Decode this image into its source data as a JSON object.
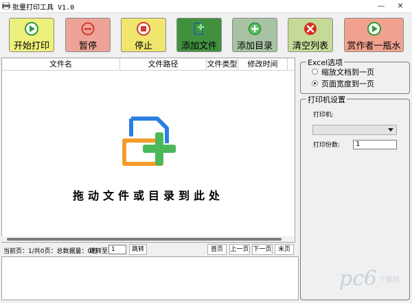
{
  "window": {
    "title": "批量打印工具 V1.0",
    "minimize": "—",
    "close": "✕"
  },
  "toolbar": {
    "buttons": [
      {
        "label": "开始打印",
        "icon": "play-icon"
      },
      {
        "label": "暂停",
        "icon": "minus-icon"
      },
      {
        "label": "停止",
        "icon": "stop-icon"
      },
      {
        "label": "添加文件",
        "icon": "add-file-icon"
      },
      {
        "label": "添加目录",
        "icon": "plus-icon"
      },
      {
        "label": "清空列表",
        "icon": "close-icon"
      },
      {
        "label": "赏作者一瓶水",
        "icon": "play-icon"
      }
    ]
  },
  "file_list": {
    "columns": [
      "文件名",
      "文件路径",
      "文件类型",
      "修改时间"
    ],
    "drop_hint": "拖动文件或目录到此处"
  },
  "pager": {
    "status": "当前页：1/共0页：总数据量：0行",
    "jump_label": "跳转至",
    "page_input": "1",
    "jump_button": "跳转",
    "first": "首页",
    "prev": "上一页",
    "next": "下一页",
    "last": "末页"
  },
  "excel": {
    "title": "Excel选项",
    "options": [
      "缩放文档到一页",
      "页面宽度到一页"
    ],
    "selected_index": 1
  },
  "printer": {
    "title": "打印机设置",
    "printer_label": "打印机:",
    "printer_value": "",
    "copies_label": "打印份数:",
    "copies_value": "1"
  },
  "watermark": {
    "text": "pc6",
    "sub": "下载站"
  },
  "colors": {
    "start_bg": "#eef07c",
    "pause_bg": "#eea397",
    "stop_bg": "#f0e66e",
    "addfile_bg": "#41923f",
    "adddir_bg": "#a8c3a4",
    "clear_bg": "#c6da98",
    "donate_bg": "#f0a28e",
    "green_icon": "#2e9a3a",
    "red_icon": "#d33b2f"
  }
}
